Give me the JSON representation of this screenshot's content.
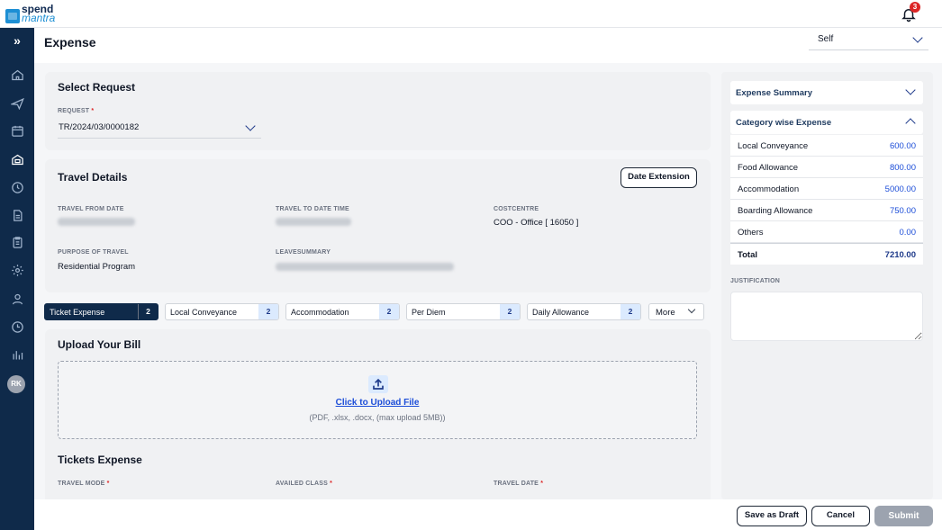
{
  "app": {
    "logo_line1": "spend",
    "logo_line2": "mantra",
    "notification_count": "3"
  },
  "sidebar": {
    "toggle_label": "»",
    "items": [
      "home-icon",
      "airplane-icon",
      "calendar-icon",
      "expense-icon",
      "history-icon",
      "document-icon",
      "clipboard-icon",
      "settings-icon",
      "user-icon",
      "clock-icon",
      "reports-icon"
    ],
    "avatar_initials": "RK"
  },
  "header": {
    "title": "Expense",
    "self_select": "Self"
  },
  "select_request": {
    "title": "Select Request",
    "request_label": "REQUEST",
    "request_value": "TR/2024/03/0000182"
  },
  "travel_details": {
    "title": "Travel Details",
    "date_extension_button": "Date Extension",
    "travel_from_date_label": "TRAVEL FROM DATE",
    "travel_to_date_time_label": "TRAVEL TO DATE TIME",
    "costcentre_label": "COSTCENTRE",
    "costcentre_value": "COO - Office [ 16050 ]",
    "purpose_label": "PURPOSE OF TRAVEL",
    "purpose_value": "Residential Program",
    "leave_summary_label": "LEAVESUMMARY"
  },
  "tabs": [
    {
      "label": "Ticket Expense",
      "count": "2"
    },
    {
      "label": "Local Conveyance",
      "count": "2"
    },
    {
      "label": "Accommodation",
      "count": "2"
    },
    {
      "label": "Per Diem",
      "count": "2"
    },
    {
      "label": "Daily Allowance",
      "count": "2"
    }
  ],
  "more_tab": "More",
  "upload": {
    "title": "Upload Your Bill",
    "link": "Click to Upload File",
    "hint": "(PDF, .xlsx, .docx, (max upload 5MB))"
  },
  "tickets_expense": {
    "title": "Tickets Expense",
    "travel_mode_label": "TRAVEL MODE",
    "availed_class_label": "AVAILED CLASS",
    "travel_date_label": "TRAVEL DATE"
  },
  "summary": {
    "expense_summary_title": "Expense Summary",
    "category_title": "Category wise Expense",
    "rows": [
      {
        "name": "Local Conveyance",
        "amount": "600.00"
      },
      {
        "name": "Food Allowance",
        "amount": "800.00"
      },
      {
        "name": "Accommodation",
        "amount": "5000.00"
      },
      {
        "name": "Boarding Allowance",
        "amount": "750.00"
      },
      {
        "name": "Others",
        "amount": "0.00"
      }
    ],
    "total_label": "Total",
    "total_amount": "7210.00",
    "justification_label": "JUSTIFICATION"
  },
  "footer": {
    "save_draft": "Save as Draft",
    "cancel": "Cancel",
    "submit": "Submit"
  }
}
